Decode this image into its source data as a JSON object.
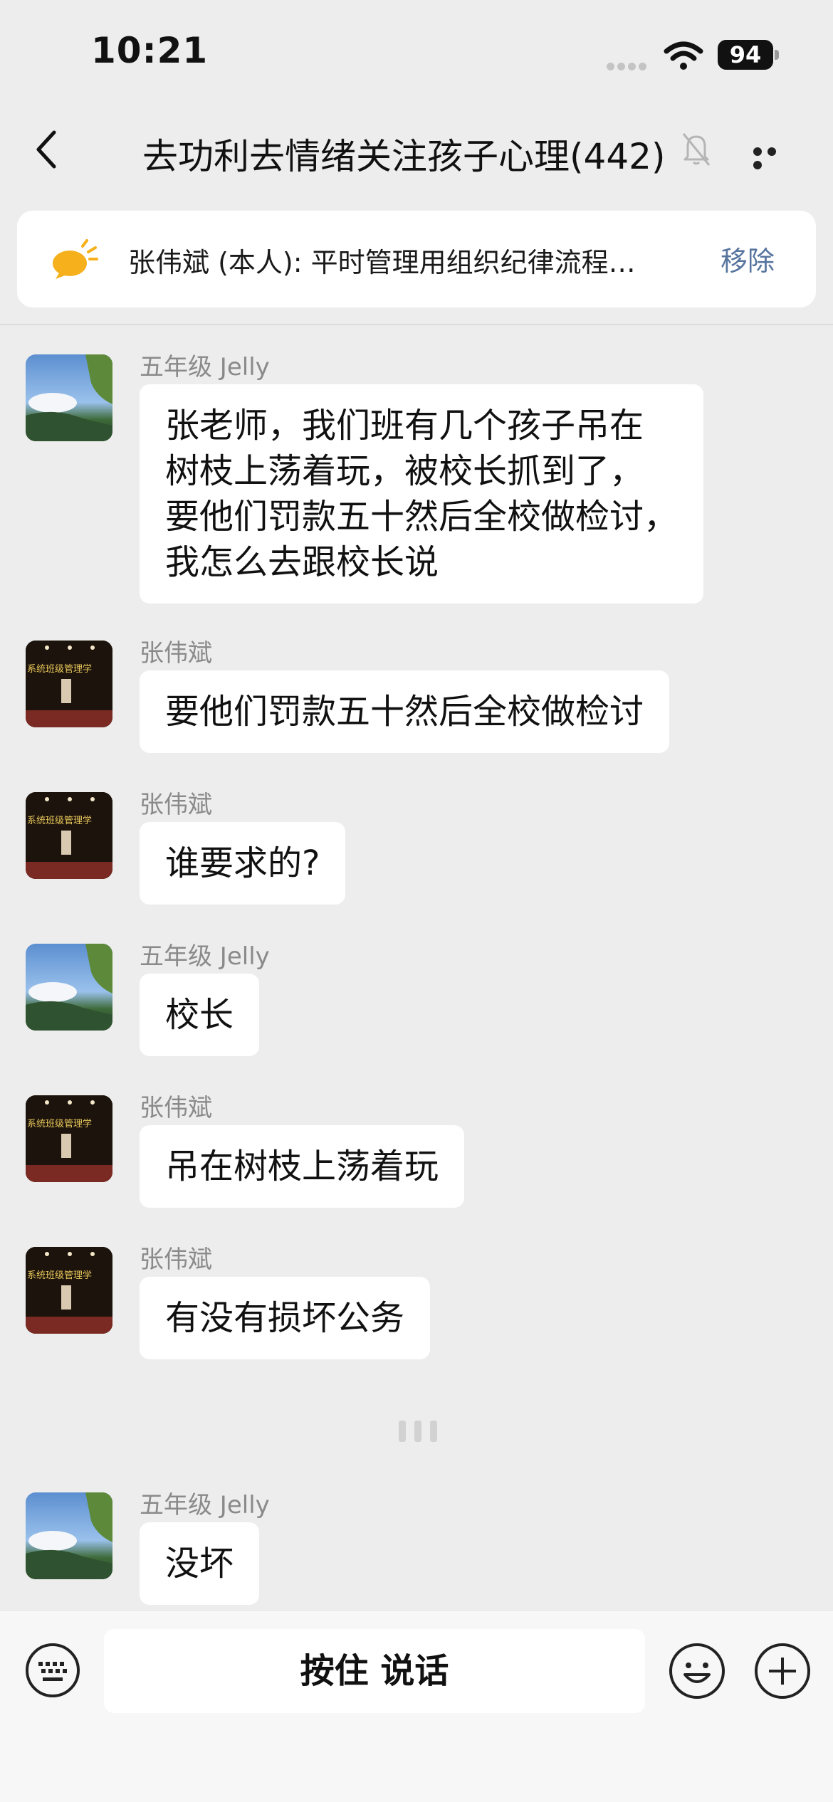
{
  "status_bar": {
    "time": "10:21",
    "battery": "94",
    "icons": [
      "cellular-signal-icon",
      "wifi-icon",
      "battery-icon"
    ]
  },
  "nav": {
    "title": "去功利去情绪关注孩子心理(442)",
    "icons": [
      "back-icon",
      "mute-bell-icon",
      "more-icon"
    ]
  },
  "pinned": {
    "text": "张伟斌 (本人): 平时管理用组织纪律流程…",
    "remove_label": "移除",
    "icon": "speech-bubble-icon"
  },
  "messages": [
    {
      "sender": "五年级 Jelly",
      "avatar": "sky-avatar",
      "lines": [
        "张老师，我们班有几个孩子吊在",
        "树枝上荡着玩，被校长抓到了，",
        "要他们罚款五十然后全校做检讨，",
        "我怎么去跟校长说"
      ]
    },
    {
      "sender": "张伟斌",
      "avatar": "stage-avatar",
      "lines": [
        "要他们罚款五十然后全校做检讨"
      ]
    },
    {
      "sender": "张伟斌",
      "avatar": "stage-avatar",
      "lines": [
        "谁要求的?"
      ]
    },
    {
      "sender": "五年级 Jelly",
      "avatar": "sky-avatar",
      "lines": [
        "校长"
      ]
    },
    {
      "sender": "张伟斌",
      "avatar": "stage-avatar",
      "lines": [
        "吊在树枝上荡着玩"
      ]
    },
    {
      "sender": "张伟斌",
      "avatar": "stage-avatar",
      "lines": [
        "有没有损坏公务"
      ]
    },
    {
      "sender": "五年级 Jelly",
      "avatar": "sky-avatar",
      "lines": [
        "没坏"
      ]
    }
  ],
  "stage_avatar_caption": "系统班级管理学",
  "input_bar": {
    "hold_to_talk": "按住 说话",
    "icons": [
      "keyboard-icon",
      "emoji-icon",
      "plus-icon"
    ]
  }
}
